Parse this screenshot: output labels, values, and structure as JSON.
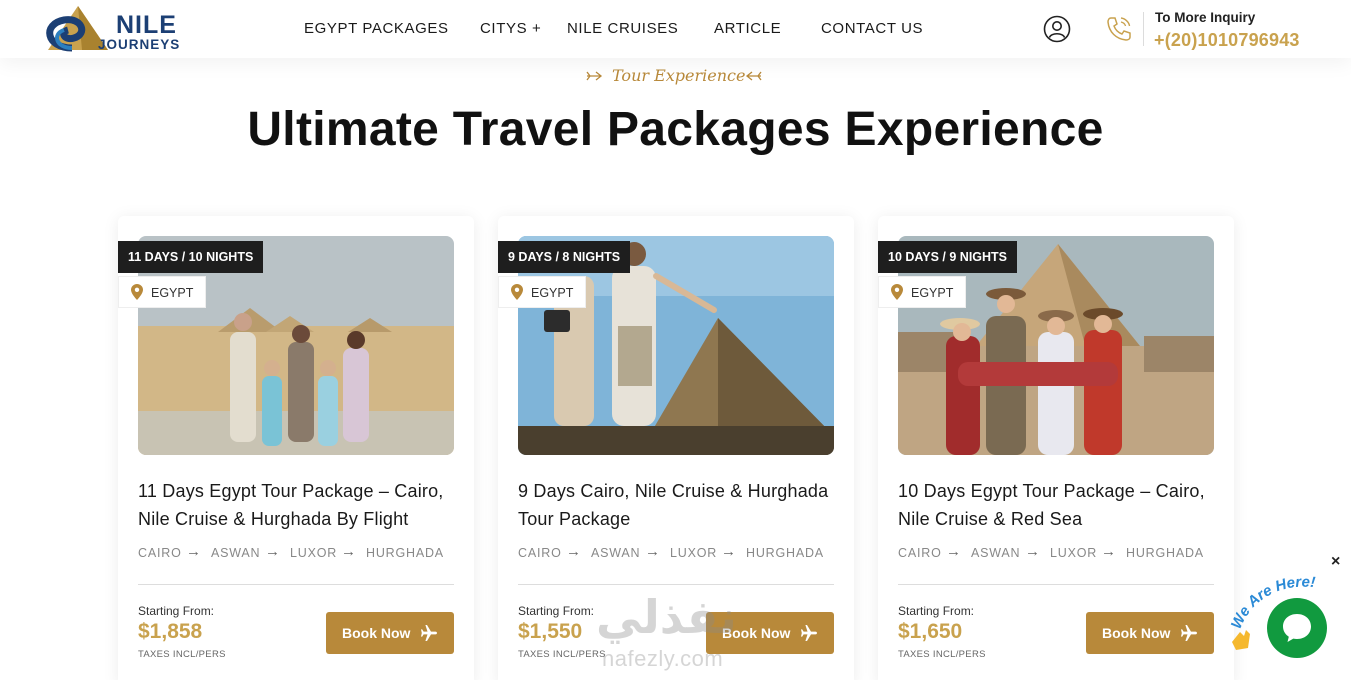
{
  "brand": {
    "name_top": "NILE",
    "name_bottom": "JOURNEYS",
    "colors": {
      "navy": "#1c3f74",
      "gold": "#c9a24e",
      "accent": "#b8893a"
    }
  },
  "nav": {
    "items": [
      "EGYPT PACKAGES",
      "CITYS +",
      "NILE CRUISES",
      "ARTICLE",
      "CONTACT US"
    ]
  },
  "header": {
    "user_icon": "user-circle-icon",
    "phone_icon": "phone-icon",
    "inquiry_label": "To More Inquiry",
    "inquiry_phone": "+(20)1010796943"
  },
  "section": {
    "eyebrow": "Tour Experience",
    "title": "Ultimate Travel Packages Experience"
  },
  "packages": [
    {
      "duration": "11 DAYS / 10 NIGHTS",
      "location": "EGYPT",
      "title": "11 Days Egypt Tour Package – Cairo, Nile Cruise & Hurghada By Flight",
      "route": [
        "CAIRO",
        "ASWAN",
        "LUXOR",
        "HURGHADA"
      ],
      "start_label": "Starting From:",
      "price": "$1,858",
      "tax_note": "TAXES INCL/PERS",
      "button": "Book Now"
    },
    {
      "duration": "9 DAYS / 8 NIGHTS",
      "location": "EGYPT",
      "title": "9 Days Cairo, Nile Cruise & Hurghada Tour Package",
      "route": [
        "CAIRO",
        "ASWAN",
        "LUXOR",
        "HURGHADA"
      ],
      "start_label": "Starting From:",
      "price": "$1,550",
      "tax_note": "TAXES INCL/PERS",
      "button": "Book Now"
    },
    {
      "duration": "10 DAYS / 9 NIGHTS",
      "location": "EGYPT",
      "title": "10 Days Egypt Tour Package – Cairo, Nile Cruise & Red Sea",
      "route": [
        "CAIRO",
        "ASWAN",
        "LUXOR",
        "HURGHADA"
      ],
      "start_label": "Starting From:",
      "price": "$1,650",
      "tax_note": "TAXES INCL/PERS",
      "button": "Book Now"
    }
  ],
  "chat": {
    "close": "×",
    "badge_text": "We Are Here!",
    "icon": "chat-bubble-icon"
  },
  "watermark": {
    "arabic": "نفذلي",
    "latin": "nafezly.com"
  }
}
